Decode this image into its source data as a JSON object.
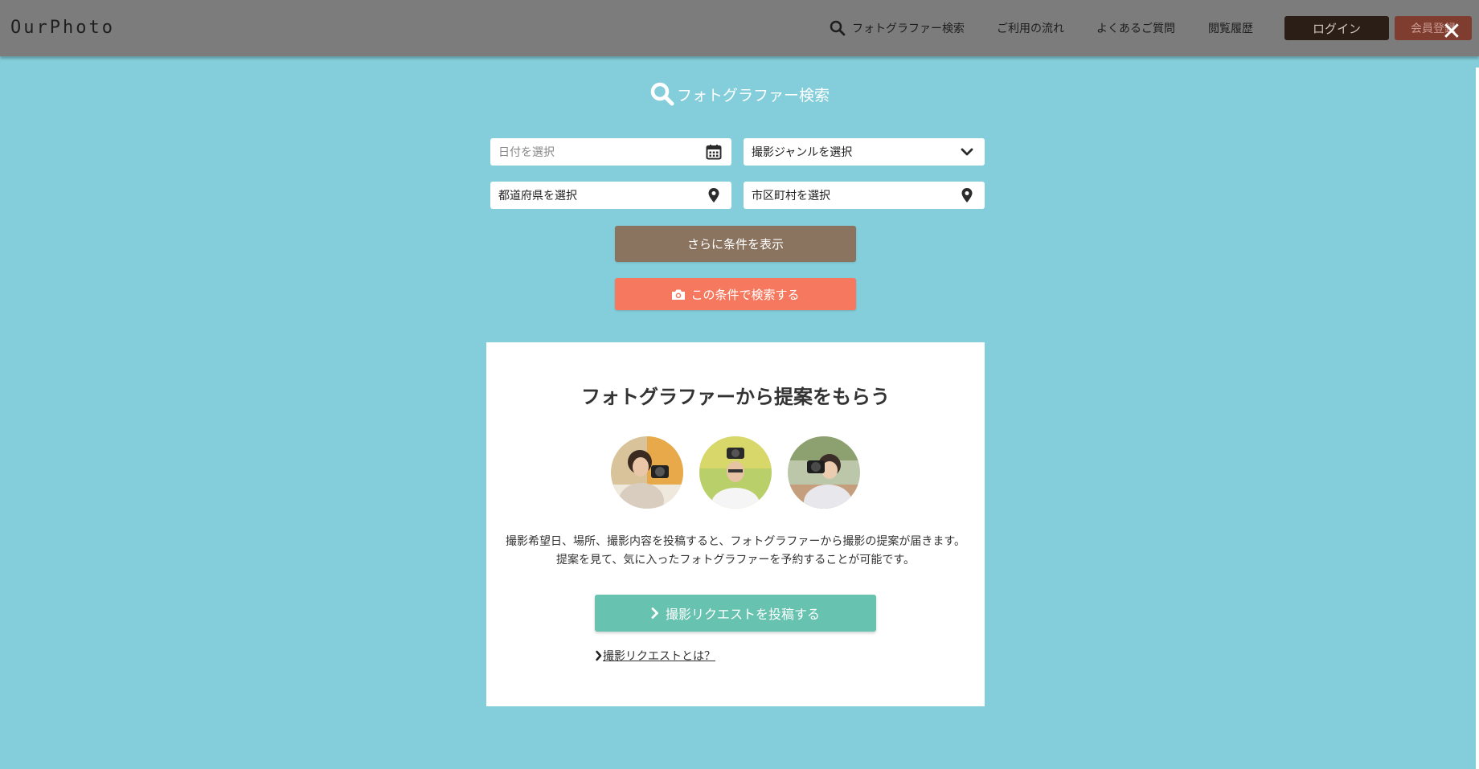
{
  "header": {
    "logo": "OurPhoto",
    "nav": {
      "search": "フォトグラファー検索",
      "flow": "ご利用の流れ",
      "faq": "よくあるご質問",
      "history": "閲覧履歴"
    },
    "login": "ログイン",
    "register": "会員登録",
    "close_icon": "close-icon"
  },
  "search": {
    "title": "フォトグラファー検索",
    "date_placeholder": "日付を選択",
    "genre": "撮影ジャンルを選択",
    "prefecture": "都道府県を選択",
    "city": "市区町村を選択",
    "more_button": "さらに条件を表示",
    "submit_button": "この条件で検索する"
  },
  "card": {
    "title": "フォトグラファーから提案をもらう",
    "description_line1": "撮影希望日、場所、撮影内容を投稿すると、フォトグラファーから撮影の提案が届きます。",
    "description_line2": "提案を見て、気に入ったフォトグラファーを予約することが可能です。",
    "request_button": "撮影リクエストを投稿する",
    "request_link": "撮影リクエストとは？"
  },
  "colors": {
    "overlay_bg": "#84cedb",
    "more_button": "#8a735f",
    "search_button": "#f6795f",
    "request_button": "#67c3af"
  }
}
